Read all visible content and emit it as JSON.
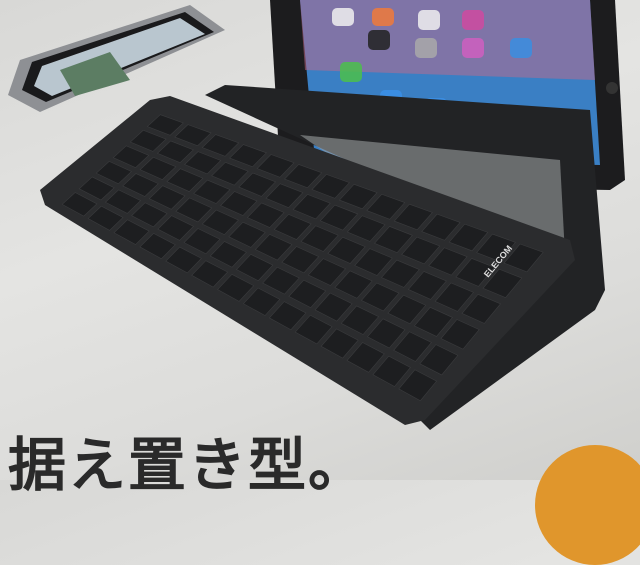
{
  "product": {
    "brand_logo": "ELECOM",
    "headline": "据え置き型。"
  },
  "colors": {
    "keyboard": "#2b2c2e",
    "key": "#1d1e20",
    "tablet_screen": "#3a7fc4",
    "badge": "#e0962c"
  }
}
